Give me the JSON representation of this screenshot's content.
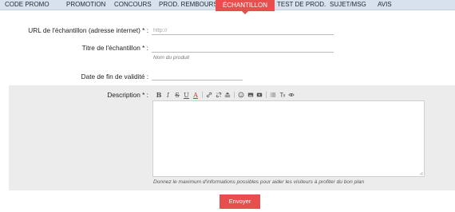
{
  "nav": {
    "items": [
      {
        "label": "CODE PROMO"
      },
      {
        "label": "PROMOTION"
      },
      {
        "label": "CONCOURS"
      },
      {
        "label": "PROD. REMBOURSÉ"
      },
      {
        "label": "ÉCHANTILLON"
      },
      {
        "label": "TEST DE PROD."
      },
      {
        "label": "SUJET/MSG"
      },
      {
        "label": "AVIS"
      }
    ],
    "active_index": 4,
    "background": "#d8e2ec",
    "active_color": "#e94e4e"
  },
  "form": {
    "url": {
      "label": "URL de l'échantillon (adresse internet) * :",
      "value": "",
      "placeholder": "http://"
    },
    "title": {
      "label": "Titre de l'échantillon * :",
      "value": "",
      "placeholder": "",
      "hint": "Nom du produit"
    },
    "end_date": {
      "label": "Date de fin de validité :",
      "value": "",
      "placeholder": ""
    },
    "description": {
      "label": "Description * :",
      "value": "",
      "hint": "Donnez le maximum d'informations possibles pour aider les visiteurs à profiter du bon plan",
      "toolbar": {
        "icons": [
          "bold-icon",
          "italic-icon",
          "strikethrough-icon",
          "underline-icon",
          "font-color-icon",
          "link-icon",
          "unlink-icon",
          "align-icon",
          "emoji-icon",
          "image-icon",
          "video-icon",
          "list-icon",
          "text-size-icon",
          "preview-icon"
        ],
        "bold": "B",
        "italic": "I",
        "strike": "S",
        "underline": "U",
        "color": "A"
      }
    },
    "submit_label": "Envoyer",
    "accent_color": "#e94e4e"
  }
}
